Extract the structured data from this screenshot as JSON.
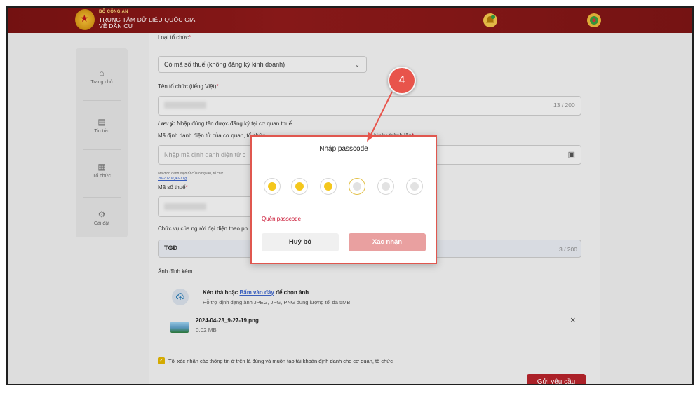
{
  "header": {
    "org": "BỘ CÔNG AN",
    "title_line1": "TRUNG TÂM DỮ LIỆU QUỐC GIA",
    "title_line2": "VỀ DÂN CƯ"
  },
  "sidebar": {
    "items": [
      {
        "label": "Trang chủ",
        "icon": "home-icon"
      },
      {
        "label": "Tin tức",
        "icon": "news-icon"
      },
      {
        "label": "Tổ chức",
        "icon": "organization-icon"
      },
      {
        "label": "Cài đặt",
        "icon": "settings-icon"
      }
    ]
  },
  "form": {
    "org_type_label": "Loại tổ chức",
    "org_type_value": "Có mã số thuế (không đăng ký kinh doanh)",
    "org_name_label": "Tên tổ chức (tiếng Việt)",
    "org_name_counter": "13 / 200",
    "note_prefix": "Lưu ý:",
    "note_text": "Nhập đúng tên được đăng ký tại cơ quan thuế",
    "eid_label": "Mã định danh điện tử của cơ quan, tổ chức",
    "eid_placeholder": "Nhập mã định danh điện tử c",
    "founding_date_label": "Ngày thành lập",
    "eid_hint": "Mã định danh điện tử của cơ quan, tổ chứ",
    "eid_hint_link": "20/2020/QĐ-TTg",
    "tax_code_label": "Mã số thuế",
    "position_label": "Chức vụ của người đại diện theo ph",
    "position_value": "TGĐ",
    "position_counter": "3 / 200",
    "attachments_label": "Ảnh đính kèm",
    "upload_prefix": "Kéo thả hoặc",
    "upload_link": "Bấm vào đây",
    "upload_suffix": "để chọn ảnh",
    "upload_hint": "Hỗ trợ định dạng ảnh JPEG, JPG, PNG dung lượng tối đa 5MB",
    "file_name": "2024-04-23_9-27-19.png",
    "file_size": "0.02 MB",
    "confirm_text": "Tôi xác nhận các thông tin ở trên là đúng và muốn tạo tài khoản định danh cho cơ quan, tổ chức",
    "submit_label": "Gửi yêu cầu"
  },
  "modal": {
    "title": "Nhập passcode",
    "filled_count": 3,
    "total_digits": 6,
    "forgot_label": "Quên passcode",
    "cancel_label": "Huỷ bỏ",
    "confirm_label": "Xác nhận"
  },
  "annotation": {
    "step": "4"
  },
  "colors": {
    "header_bg": "#7a1212",
    "accent_red": "#c8102e",
    "submit_bg": "#b5232b",
    "passcode_filled": "#f4c71c",
    "confirm_disabled": "#e9a0a0",
    "callout": "#e8544b"
  }
}
